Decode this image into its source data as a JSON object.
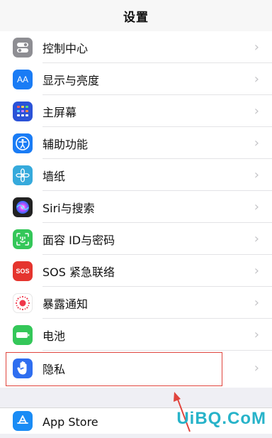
{
  "nav": {
    "title": "设置"
  },
  "group1": [
    {
      "id": "control-center",
      "label": "控制中心",
      "icon": "toggles-icon",
      "color": "#8e8e93"
    },
    {
      "id": "display",
      "label": "显示与亮度",
      "icon": "text-size-icon",
      "icon_text": "AA",
      "color": "#1a7cf5"
    },
    {
      "id": "home-screen",
      "label": "主屏幕",
      "icon": "grid-icon",
      "color": "#2b53d8"
    },
    {
      "id": "accessibility",
      "label": "辅助功能",
      "icon": "accessibility-icon",
      "color": "#1a7cf5"
    },
    {
      "id": "wallpaper",
      "label": "墙纸",
      "icon": "flower-icon",
      "color": "#36aadc"
    },
    {
      "id": "siri",
      "label": "Siri与搜索",
      "icon": "siri-icon",
      "color": "#222"
    },
    {
      "id": "face-id",
      "label": "面容 ID与密码",
      "icon": "face-id-icon",
      "color": "#34c759"
    },
    {
      "id": "sos",
      "label": "SOS 紧急联络",
      "icon": "sos-icon",
      "icon_text": "SOS",
      "color": "#e5352e"
    },
    {
      "id": "exposure",
      "label": "暴露通知",
      "icon": "exposure-icon",
      "color": "#ffffff"
    },
    {
      "id": "battery",
      "label": "电池",
      "icon": "battery-icon",
      "color": "#34c759"
    },
    {
      "id": "privacy",
      "label": "隐私",
      "icon": "hand-icon",
      "color": "#2f6ef0"
    }
  ],
  "group2": [
    {
      "id": "app-store",
      "label": "App Store",
      "icon": "app-store-icon",
      "color": "#1a8cf5"
    }
  ],
  "chevron": "›",
  "watermark": "UiBQ.CoM"
}
